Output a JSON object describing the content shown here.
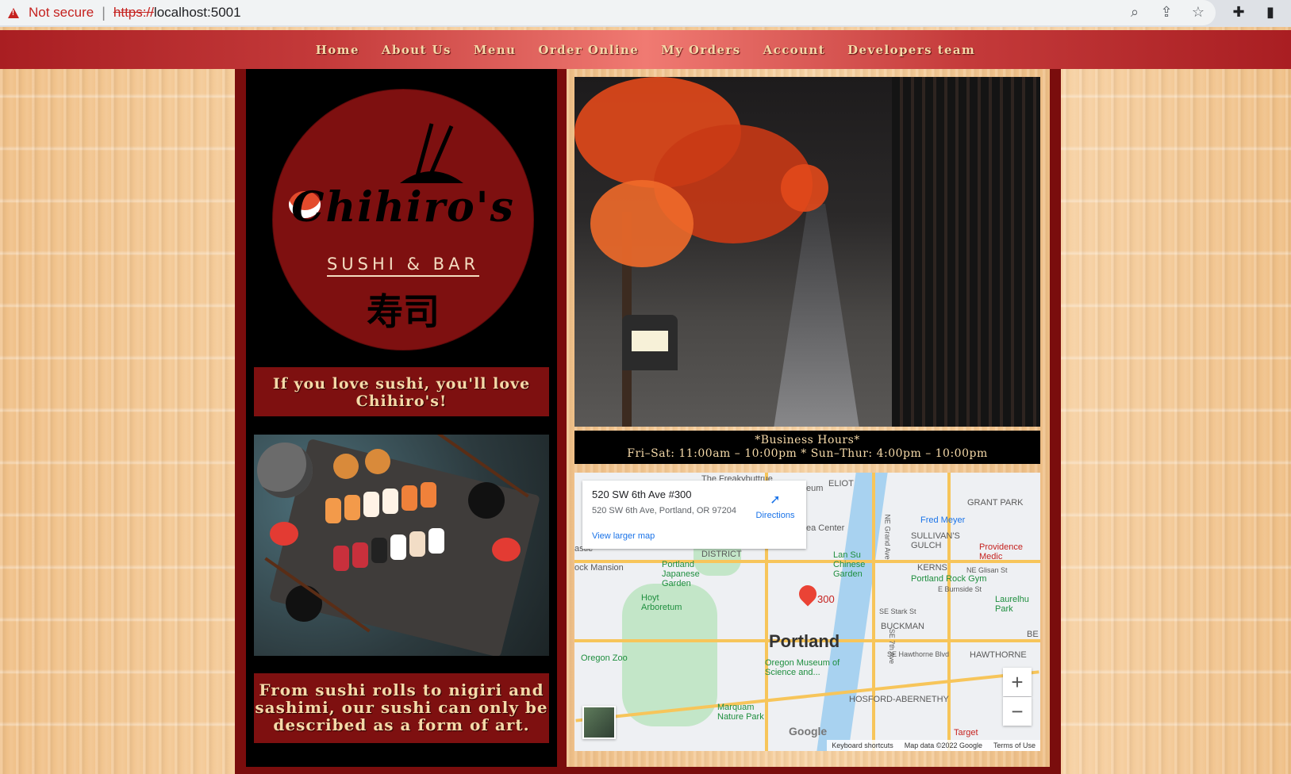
{
  "browser": {
    "not_secure": "Not secure",
    "separator": "|",
    "url_scheme": "https://",
    "url_rest": "localhost:5001",
    "icons": [
      "zoom-icon",
      "share-icon",
      "star-icon",
      "extension-icon",
      "sidepanel-icon"
    ]
  },
  "nav": {
    "items": [
      "Home",
      "About Us",
      "Menu",
      "Order Online",
      "My Orders",
      "Account",
      "Developers team"
    ]
  },
  "logo": {
    "name": "Chihiro's",
    "sub": "SUSHI & BAR",
    "kanji": "寿司"
  },
  "left": {
    "tagline1": "If you love sushi, you'll love Chihiro's!",
    "tagline2": "From sushi rolls to nigiri and sashimi, our sushi can only be described as a form of art."
  },
  "hours": {
    "title": "*Business Hours*",
    "text": "Fri–Sat: 11:00am – 10:00pm * Sun–Thur: 4:00pm – 10:00pm"
  },
  "map": {
    "place_title": "520 SW 6th Ave #300",
    "place_address": "520 SW 6th Ave, Portland, OR 97204",
    "directions": "Directions",
    "larger_map": "View larger map",
    "city": "Portland",
    "pin_label": "300",
    "zoom_in": "+",
    "zoom_out": "−",
    "google": "Google",
    "keyboard": "Keyboard shortcuts",
    "mapdata": "Map data ©2022 Google",
    "terms": "Terms of Use",
    "labels": [
      "The Freakybuttrue",
      "ELIOT",
      "GRANT PARK",
      "Fred Meyer",
      "SULLIVAN'S GULCH",
      "Providence Medic",
      "DISTRICT",
      "Lan Su Chinese Garden",
      "KERNS",
      "Portland Rock Gym",
      "ock Mansion",
      "Portland Japanese Garden",
      "Hoyt Arboretum",
      "Laurelhu Park",
      "BUCKMAN",
      "Oregon Zoo",
      "Oregon Museum of Science and...",
      "HAWTHORNE",
      "HOSFORD-ABERNETHY",
      "Marquam Nature Park",
      "Target",
      "SE Hawthorne Blvd",
      "SE Stark St",
      "NE Glisan St",
      "E Burnside St",
      "NE Grand Ave",
      "SE 7th Ave",
      "ea Center",
      "eum",
      "astle",
      "BE"
    ]
  }
}
